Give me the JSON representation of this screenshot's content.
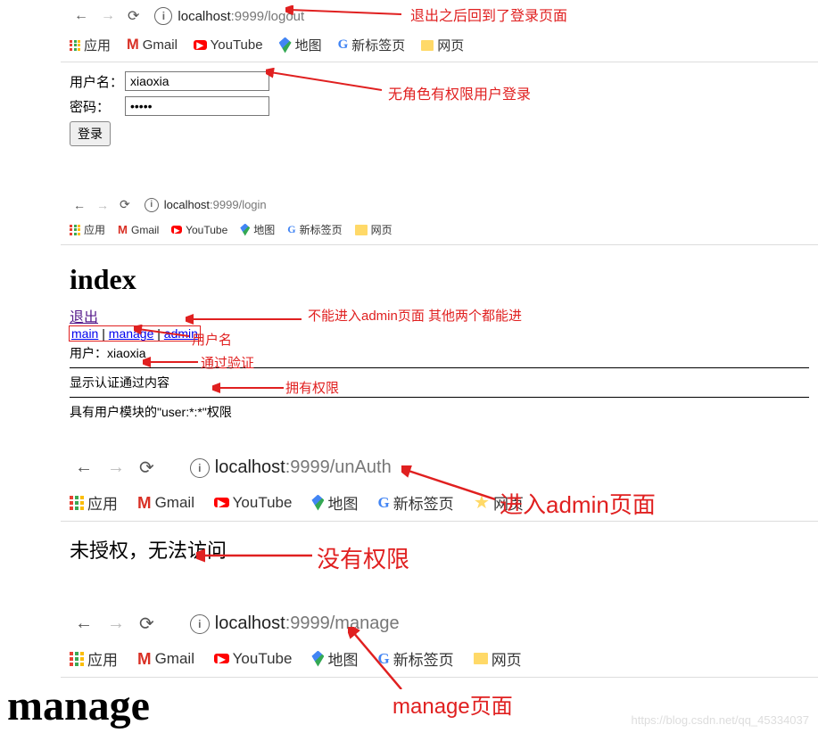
{
  "section1": {
    "url_host": "localhost",
    "url_rest": ":9999/logout",
    "annotation": "退出之后回到了登录页面",
    "bookmarks": {
      "apps": "应用",
      "gmail": "Gmail",
      "youtube": "YouTube",
      "maps": "地图",
      "newtab": "新标签页",
      "web": "网页"
    },
    "form": {
      "user_label": "用户名：",
      "user_value": "xiaoxia",
      "pass_label": "密码：",
      "pass_value": "•••••",
      "login_btn": "登录"
    },
    "annotation2": "无角色有权限用户登录"
  },
  "section2": {
    "url_host": "localhost",
    "url_rest": ":9999/login",
    "bookmarks": {
      "apps": "应用",
      "gmail": "Gmail",
      "youtube": "YouTube",
      "maps": "地图",
      "newtab": "新标签页",
      "web": "网页"
    },
    "title": "index",
    "logout_link": "退出",
    "links": {
      "main": "main",
      "sep1": " | ",
      "manage": "manage",
      "sep2": " | ",
      "admin": "admin"
    },
    "user_label": "用户：",
    "user_value": "xiaoxia",
    "line1": "显示认证通过内容",
    "line2": "具有用户模块的\"user:*:*\"权限",
    "ann_links": "不能进入admin页面 其他两个都能进",
    "ann_user": "用户名",
    "ann_auth": "通过验证",
    "ann_perm": "拥有权限"
  },
  "section3": {
    "url_host": "localhost",
    "url_rest": ":9999/unAuth",
    "bookmarks": {
      "apps": "应用",
      "gmail": "Gmail",
      "youtube": "YouTube",
      "maps": "地图",
      "newtab": "新标签页",
      "web": "网页"
    },
    "body_text": "未授权，无法访问",
    "ann_enter": "进入admin页面",
    "ann_noperm": "没有权限"
  },
  "section4": {
    "url_host": "localhost",
    "url_rest": ":9999/manage",
    "bookmarks": {
      "apps": "应用",
      "gmail": "Gmail",
      "youtube": "YouTube",
      "maps": "地图",
      "newtab": "新标签页",
      "web": "网页"
    },
    "title": "manage",
    "ann_page": "manage页面"
  },
  "watermark": "https://blog.csdn.net/qq_45334037"
}
